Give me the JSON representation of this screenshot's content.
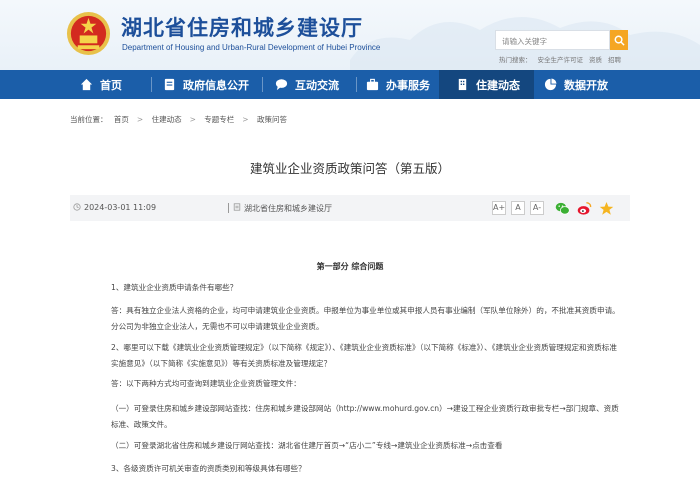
{
  "header": {
    "title": "湖北省住房和城乡建设厅",
    "subtitle": "Department of Housing and Urban-Rural Development of Hubei Province",
    "search_placeholder": "请输入关键字",
    "hot_label": "热门搜索：",
    "hot_items": [
      "安全生产许可证",
      "资质",
      "招聘"
    ]
  },
  "nav": {
    "items": [
      {
        "label": "首页",
        "icon": "home-icon"
      },
      {
        "label": "政府信息公开",
        "icon": "info-icon"
      },
      {
        "label": "互动交流",
        "icon": "chat-icon"
      },
      {
        "label": "办事服务",
        "icon": "service-icon"
      },
      {
        "label": "住建动态",
        "icon": "building-icon"
      },
      {
        "label": "数据开放",
        "icon": "chart-icon"
      }
    ],
    "active": "住建动态"
  },
  "breadcrumb": {
    "prefix": "当前位置：",
    "items": [
      "首页",
      "住建动态",
      "专题专栏",
      "政策问答"
    ]
  },
  "article": {
    "title": "建筑业企业资质政策问答（第五版）",
    "date": "2024-03-01 11:09",
    "source": "湖北省住房和城乡建设厅",
    "font_sizes": [
      "A+",
      "A",
      "A-"
    ],
    "share_icons": [
      "wechat-icon",
      "weibo-icon",
      "favorite-icon"
    ],
    "section_heading": "第一部分   综合问题",
    "paragraphs": [
      "1、建筑业企业资质申请条件有哪些？",
      "答：具有独立企业法人资格的企业，均可申请建筑业企业资质。申报单位为事业单位或其申报人员有事业编制（军队单位除外）的，不批准其资质申请。分公司为非独立企业法人，无需也不可以申请建筑业企业资质。",
      "2、哪里可以下载《建筑业企业资质管理规定》（以下简称《规定》）、《建筑业企业资质标准》（以下简称《标准》）、《建筑业企业资质管理规定和资质标准实施意见》（以下简称《实施意见》）等有关资质标准及管理规定？",
      "答：以下两种方式均可查询到建筑业企业资质管理文件：",
      "（一）可登录住房和城乡建设部网站查找：住房和城乡建设部网站（http://www.mohurd.gov.cn）→建设工程企业资质行政审批专栏→部门规章、资质标准、政策文件。",
      "（二）可登录湖北省住房和城乡建设厅网站查找：湖北省住建厅首页→“店小二”专线→建筑业企业资质标准→点击查看",
      "3、各级资质许可机关审查的资质类别和等级具体有哪些？"
    ]
  },
  "colors": {
    "brand_blue": "#1b5ea9",
    "active_nav": "#14477f",
    "search_button": "#f5a623",
    "title_blue": "#1d4f9a"
  }
}
